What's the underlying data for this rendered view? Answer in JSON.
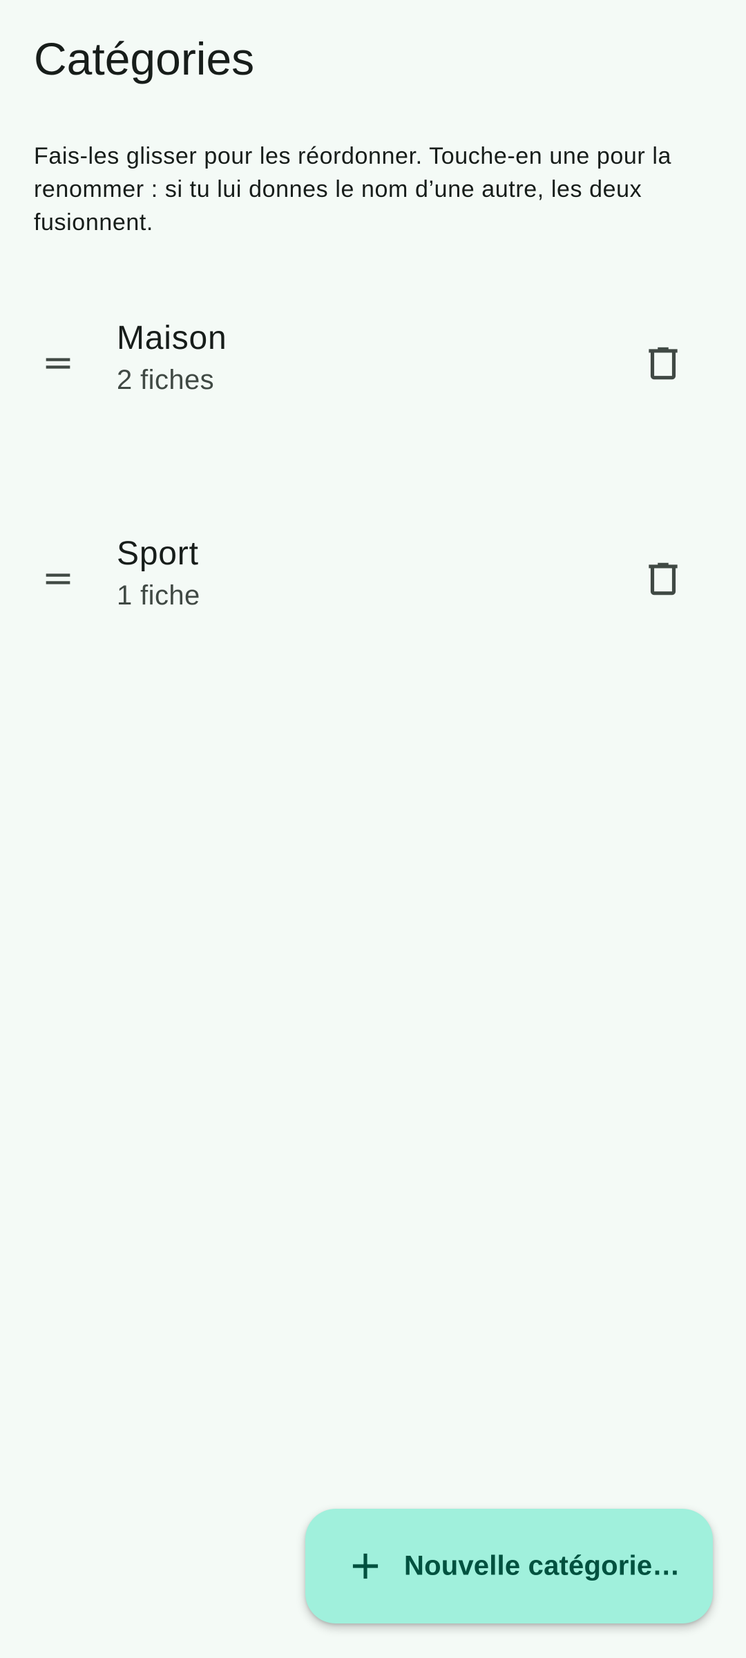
{
  "header": {
    "title": "Catégories"
  },
  "hint": {
    "text": "Fais-les glisser pour les réordonner. Touche-en une pour la renommer : si tu lui donnes le nom d’une autre, les deux fusionnent."
  },
  "categories": [
    {
      "name": "Maison",
      "count": "2 fiches",
      "drag_icon": "drag-handle-icon",
      "delete_icon": "trash-icon"
    },
    {
      "name": "Sport",
      "count": "1 fiche",
      "drag_icon": "drag-handle-icon",
      "delete_icon": "trash-icon"
    }
  ],
  "fab": {
    "label": "Nouvelle catégorie…",
    "icon": "plus-icon"
  },
  "colors": {
    "background": "#f4faf6",
    "fab_background": "#a0f0dc",
    "fab_foreground": "#00513f",
    "icon": "#404944"
  }
}
